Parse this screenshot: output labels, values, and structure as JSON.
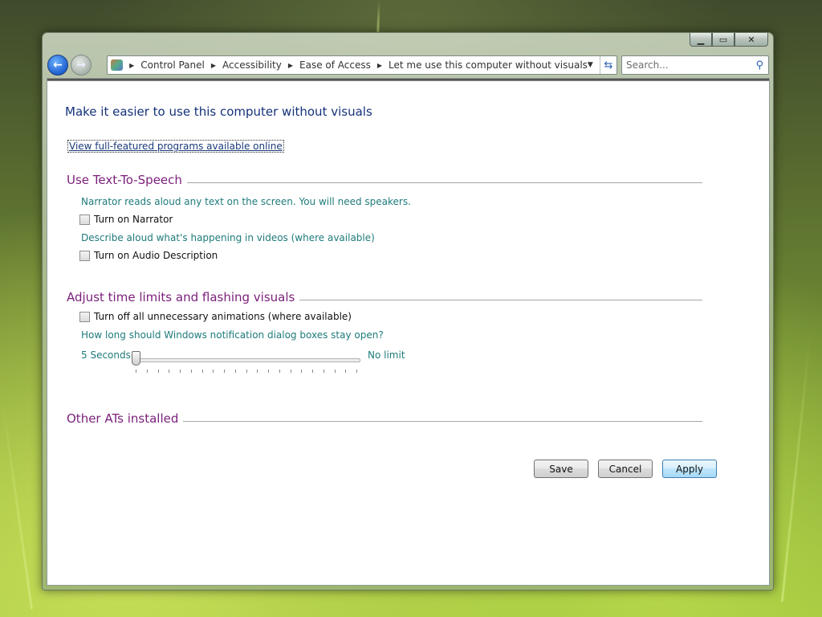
{
  "window": {
    "caption_buttons": {
      "minimize": "▁",
      "maximize": "▭",
      "close": "✕"
    }
  },
  "nav": {
    "back_icon": "back-arrow-icon",
    "forward_icon": "forward-arrow-icon"
  },
  "address": {
    "breadcrumbs": [
      "Control Panel",
      "Accessibility",
      "Ease of Access",
      "Let me use this computer without visuals"
    ]
  },
  "search": {
    "placeholder": "Search..."
  },
  "main": {
    "title": "Make it easier to use this computer without visuals",
    "online_link": "View full-featured programs available online",
    "sections": {
      "tts": {
        "heading": "Use Text-To-Speech",
        "narrator_desc": "Narrator reads aloud any text on the screen. You will need speakers.",
        "narrator_check": "Turn on Narrator",
        "audio_desc": "Describe aloud what's happening in videos (where available)",
        "audio_check": "Turn on Audio Description"
      },
      "time": {
        "heading": "Adjust time limits and flashing visuals",
        "animations_check": "Turn off all unnecessary animations (where available)",
        "notification_question": "How long should Windows notification dialog boxes stay open?",
        "slider_min": "5 Seconds",
        "slider_max": "No limit"
      },
      "ats": {
        "heading": "Other ATs installed"
      }
    },
    "buttons": {
      "save": "Save",
      "cancel": "Cancel",
      "apply": "Apply"
    }
  }
}
